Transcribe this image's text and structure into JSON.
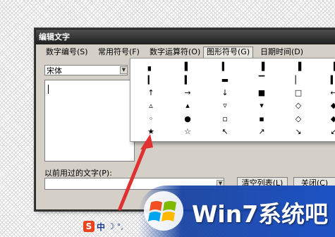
{
  "dialog": {
    "title": "编辑文字",
    "menu": [
      {
        "label": "数字编号(S)"
      },
      {
        "label": "常用符号(F)"
      },
      {
        "label": "数字运算符(O)"
      },
      {
        "label": "图形符号(G)"
      },
      {
        "label": "日期时间(D)"
      }
    ],
    "active_menu": "图形符号(G)",
    "font_select_value": "宋体",
    "history_label": "以前用过的文字(P):",
    "buttons": {
      "clear": "清空列表(L)",
      "close": "关闭(C)"
    }
  },
  "symbols": [
    [
      "▖",
      "▌",
      "▍",
      "▐",
      "▐",
      "▐"
    ],
    [
      "▎",
      "▍",
      "▬",
      "▔",
      "▏",
      "▍"
    ],
    [
      "↑",
      "→",
      "↓",
      "■",
      "□",
      "←"
    ],
    [
      "▵",
      "▴",
      "▿",
      "▾",
      "◇",
      "◆"
    ],
    [
      "◦",
      "●",
      "▫",
      "▪",
      "◇",
      "◆"
    ],
    [
      "★",
      "☆",
      "↖",
      "↗",
      "↘",
      "↙"
    ]
  ],
  "ime": {
    "logo": "S",
    "lang": "中",
    "moon": "☽",
    "punct": "°,"
  },
  "watermark": {
    "text": "Win7系统吧"
  },
  "colors": {
    "titlebar": "#2e2e2e",
    "dialog_bg": "#d4d0c8",
    "watermark_blue": "#1d52c4",
    "pointer_red": "#e03030"
  }
}
